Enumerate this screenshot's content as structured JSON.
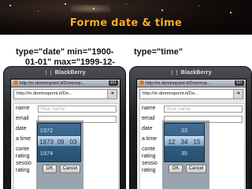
{
  "slide": {
    "title": "Forme date & time",
    "caption_left_line1": "type=\"date\" min=\"1900-",
    "caption_left_line2": "01-01\" max=\"1999-12-",
    "caption_right": "type=\"time\""
  },
  "phones": [
    {
      "brand": "BlackBerry",
      "tab_url": "http://m.dominopoint.it/Dominop...",
      "tab_count": "101",
      "url": "http://m.dominopoint.it/Do...",
      "form": {
        "labels": [
          "name",
          "email",
          "date",
          "a time",
          "conte",
          "rating",
          "sessio",
          "rating"
        ],
        "name_placeholder": "Your name"
      },
      "picker": {
        "above": "1972",
        "selected": [
          "1973",
          "09",
          "03"
        ],
        "below": "1974",
        "ok_label": "OK",
        "cancel_label": "Cancel"
      }
    },
    {
      "brand": "BlackBerry",
      "tab_url": "http://m.dominopoint.it/Dominop...",
      "tab_count": "101",
      "url": "http://m.dominopoint.it/Do...",
      "form": {
        "labels": [
          "name",
          "email",
          "date",
          "a time",
          "conte",
          "rating",
          "sessio",
          "rating"
        ],
        "name_placeholder": "Your name"
      },
      "picker": {
        "above": "33",
        "selected": [
          "12",
          "34",
          "15"
        ],
        "below": "35",
        "ok_label": "OK",
        "cancel_label": "Cancel"
      }
    }
  ],
  "colors": {
    "title": "#ffb02a",
    "picker_bg": "#2f5c80",
    "selection_band": "#9fbdd6"
  }
}
